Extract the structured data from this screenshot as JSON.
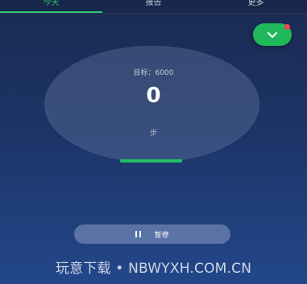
{
  "tabs": [
    {
      "label": "今天",
      "active": true
    },
    {
      "label": "报告",
      "active": false
    },
    {
      "label": "更多",
      "active": false
    }
  ],
  "goal": {
    "label": "目标：6000"
  },
  "steps": {
    "count": "0",
    "unit": "步",
    "progress_fraction": 0.0
  },
  "controls": {
    "pause_label": "暂停"
  },
  "fab": {
    "icon": "chevron-down-icon",
    "has_notification_dot": true
  },
  "watermark": "玩意下载 • NBWYXH.COM.CN",
  "colors": {
    "accent_green": "#22c065",
    "notification_red": "#ff3b5a"
  }
}
